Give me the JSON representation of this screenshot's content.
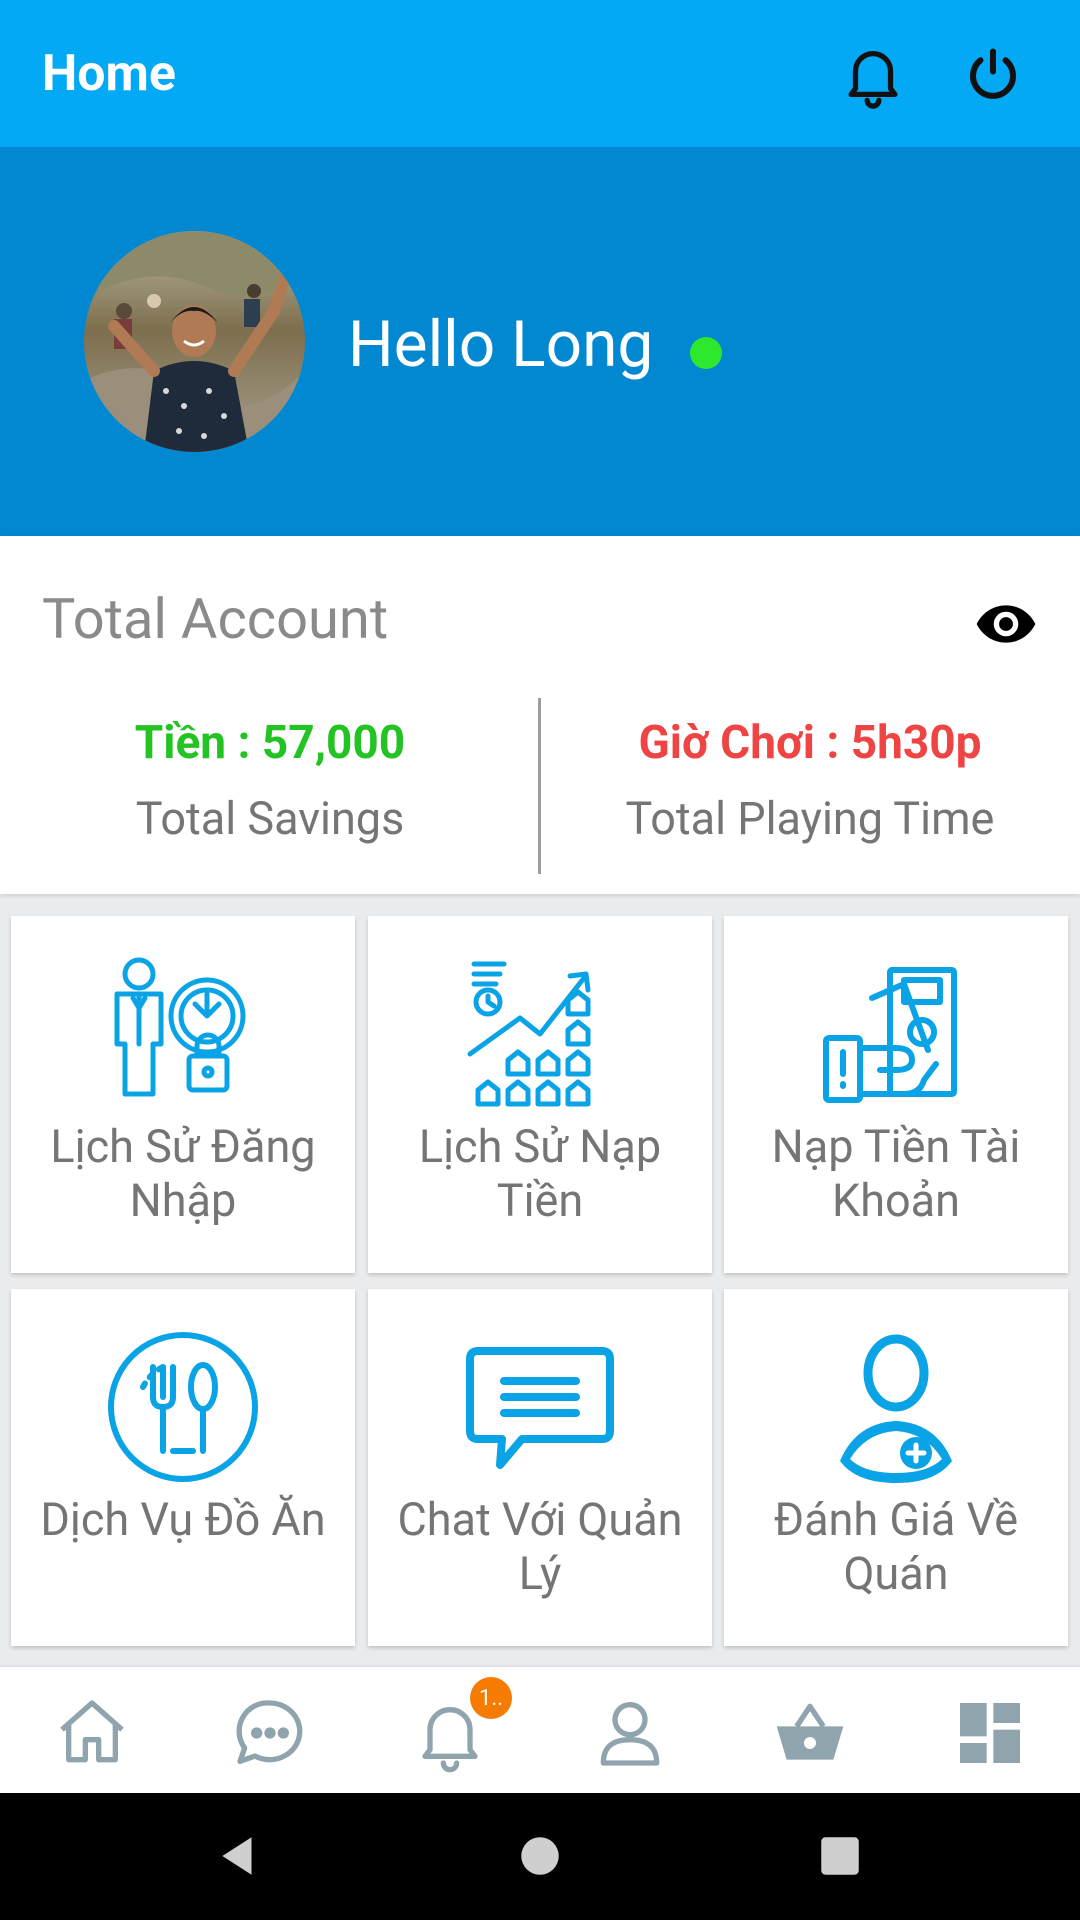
{
  "appbar": {
    "title": "Home",
    "bell_icon": "bell-icon",
    "power_icon": "power-icon"
  },
  "profile": {
    "greeting": "Hello Long",
    "status_color": "#2ee82e"
  },
  "account": {
    "heading": "Total Account",
    "visibility_icon": "eye-icon",
    "savings_value": "Tiền : 57,000",
    "savings_label": "Total Savings",
    "savings_color": "#22c322",
    "playing_value": "Giờ Chơi : 5h30p",
    "playing_label": "Total Playing Time",
    "playing_color": "#ee4444"
  },
  "tiles": [
    {
      "label": "Lịch Sử Đăng Nhập",
      "icon": "login-history-icon"
    },
    {
      "label": "Lịch Sử Nạp Tiền",
      "icon": "deposit-history-icon"
    },
    {
      "label": "Nạp Tiền Tài Khoản",
      "icon": "top-up-icon"
    },
    {
      "label": "Dịch Vụ Đồ Ăn",
      "icon": "food-service-icon"
    },
    {
      "label": "Chat Với Quản Lý",
      "icon": "chat-icon"
    },
    {
      "label": "Đánh Giá Về Quán",
      "icon": "review-icon"
    }
  ],
  "bottom_nav": {
    "items": [
      "home-icon",
      "chat-bubble-icon",
      "notification-icon",
      "profile-icon",
      "basket-icon",
      "dashboard-icon"
    ],
    "badge": "1.."
  },
  "colors": {
    "appbar": "#03a9f4",
    "banner": "#0288d1",
    "icon_blue": "#0aa3e6",
    "nav_icon": "#90a4ae"
  }
}
